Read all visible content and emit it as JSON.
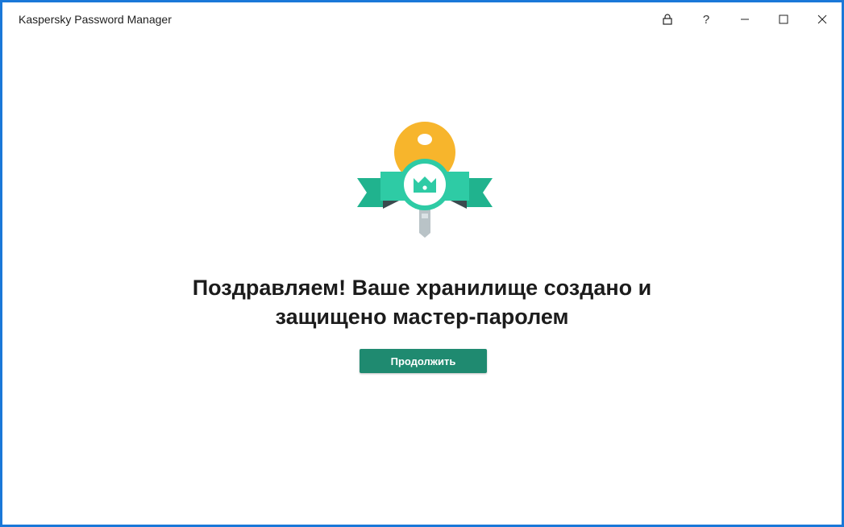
{
  "window": {
    "title": "Kaspersky Password Manager",
    "border_color": "#1a78d8"
  },
  "titlebar_controls": {
    "lock_icon": "lock-icon",
    "help_label": "?",
    "minimize_icon": "minimize-icon",
    "maximize_icon": "maximize-icon",
    "close_icon": "close-icon"
  },
  "illustration": {
    "icon": "key-crown-badge-icon",
    "colors": {
      "key": "#f7b52c",
      "badge": "#2ecba5",
      "ribbon": "#20b38e",
      "crown": "#2ecba5"
    }
  },
  "main": {
    "headline_line1": "Поздравляем! Ваше хранилище создано и",
    "headline_line2": "защищено мастер-паролем",
    "continue_label": "Продолжить",
    "accent_color": "#1f8a70"
  }
}
